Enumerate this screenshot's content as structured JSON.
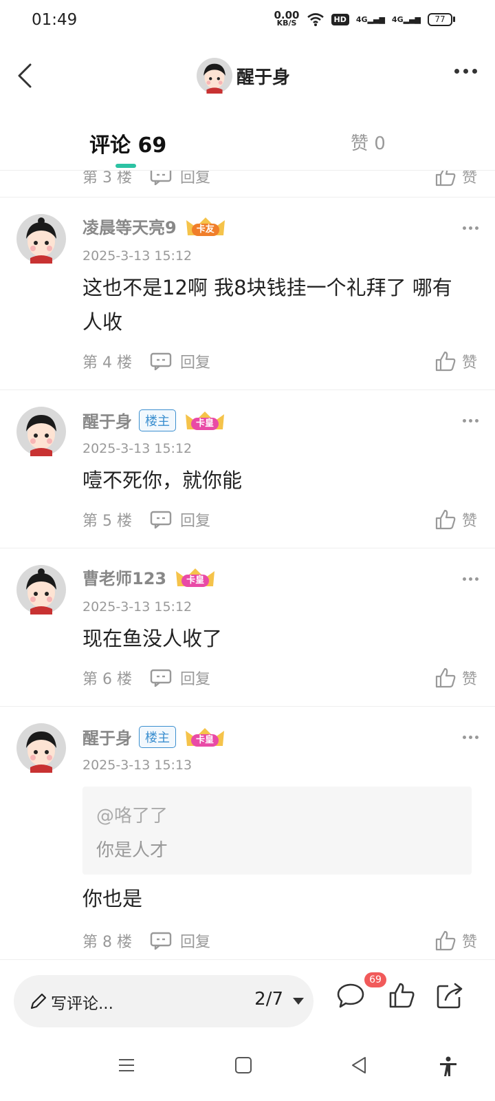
{
  "status": {
    "time": "01:49",
    "net_speed_value": "0.00",
    "net_speed_unit": "KB/S",
    "signal1": "4G",
    "signal2": "4G",
    "hd_label": "HD",
    "battery": "77"
  },
  "header": {
    "title": "醒于身"
  },
  "tabs": {
    "comments_label": "评论 69",
    "likes_label": "赞 0"
  },
  "partial_row": {
    "floor": "第 3 楼",
    "reply": "回复",
    "like": "赞"
  },
  "comments": [
    {
      "name": "凌晨等天亮9",
      "badge": "卡友",
      "badge_color": "#f07e2a",
      "date": "2025-3-13 15:12",
      "text": "这也不是12啊 我8块钱挂一个礼拜了 哪有人收",
      "floor": "第 4 楼",
      "reply": "回复",
      "like": "赞"
    },
    {
      "name": "醒于身",
      "host_badge": "楼主",
      "badge": "卡皇",
      "badge_color": "#e94aa6",
      "date": "2025-3-13 15:12",
      "text": "噎不死你，就你能",
      "floor": "第 5 楼",
      "reply": "回复",
      "like": "赞"
    },
    {
      "name": "曹老师123",
      "badge": "卡皇",
      "badge_color": "#e94aa6",
      "date": "2025-3-13 15:12",
      "text": "现在鱼没人收了",
      "floor": "第 6 楼",
      "reply": "回复",
      "like": "赞"
    },
    {
      "name": "醒于身",
      "host_badge": "楼主",
      "badge": "卡皇",
      "badge_color": "#e94aa6",
      "date": "2025-3-13 15:13",
      "quote_user": "@咯了了",
      "quote_text": "你是人才",
      "text": "你也是",
      "floor": "第 8 楼",
      "reply": "回复",
      "like": "赞"
    }
  ],
  "bottom": {
    "write_placeholder": "写评论...",
    "page": "2/7",
    "comment_count": "69"
  },
  "icons": [
    "back-icon",
    "more-icon",
    "reply-icon",
    "like-icon",
    "pen-icon",
    "comment-icon",
    "share-icon",
    "menu-icon",
    "home-icon",
    "nav-back-icon",
    "accessibility-icon"
  ],
  "colors": {
    "accent": "#2cc2a3",
    "host_badge": "#3a8ecf",
    "count_badge": "#f15a5a"
  }
}
